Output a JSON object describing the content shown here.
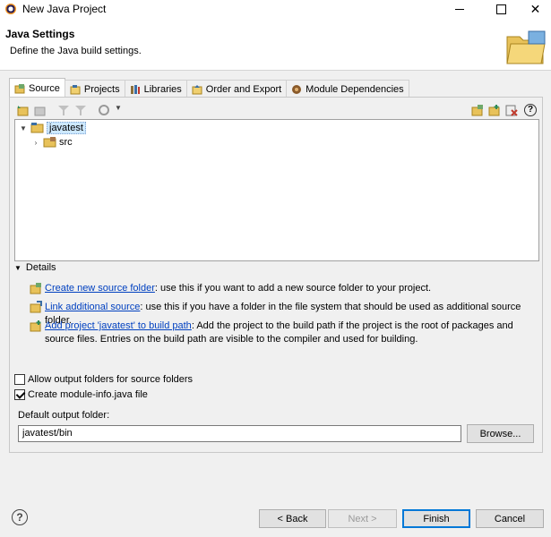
{
  "window": {
    "title": "New Java Project"
  },
  "banner": {
    "heading": "Java Settings",
    "description": "Define the Java build settings."
  },
  "tabs": [
    {
      "label": "Source",
      "icon": "source-icon",
      "active": true
    },
    {
      "label": "Projects",
      "icon": "projects-icon",
      "active": false
    },
    {
      "label": "Libraries",
      "icon": "libraries-icon",
      "active": false
    },
    {
      "label": "Order and Export",
      "icon": "order-export-icon",
      "active": false
    },
    {
      "label": "Module Dependencies",
      "icon": "module-icon",
      "active": false
    }
  ],
  "tree": {
    "items": [
      {
        "label": "javatest",
        "expanded": true
      },
      {
        "label": "src",
        "expanded": false
      }
    ]
  },
  "details": {
    "label": "Details",
    "rows": [
      {
        "link": "Create new source folder",
        "text": ": use this if you want to add a new source folder to your project."
      },
      {
        "link": "Link additional source",
        "text": ": use this if you have a folder in the file system that should be used as additional source folder."
      },
      {
        "link": "Add project 'javatest' to build path",
        "text": ": Add the project to the build path if the project is the root of packages and source files. Entries on the build path are visible to the compiler and used for building."
      }
    ]
  },
  "options": {
    "allow_output_folders": {
      "label": "Allow output folders for source folders",
      "checked": false
    },
    "create_module_info": {
      "label": "Create module-info.java file",
      "checked": true
    }
  },
  "output": {
    "label": "Default output folder:",
    "value": "javatest/bin",
    "browse_label": "Browse..."
  },
  "footer": {
    "back_label": "< Back",
    "next_label": "Next >",
    "finish_label": "Finish",
    "cancel_label": "Cancel"
  },
  "colors": {
    "link": "#0040c0",
    "primary_border": "#0078d7",
    "selection": "#cde8ff"
  }
}
